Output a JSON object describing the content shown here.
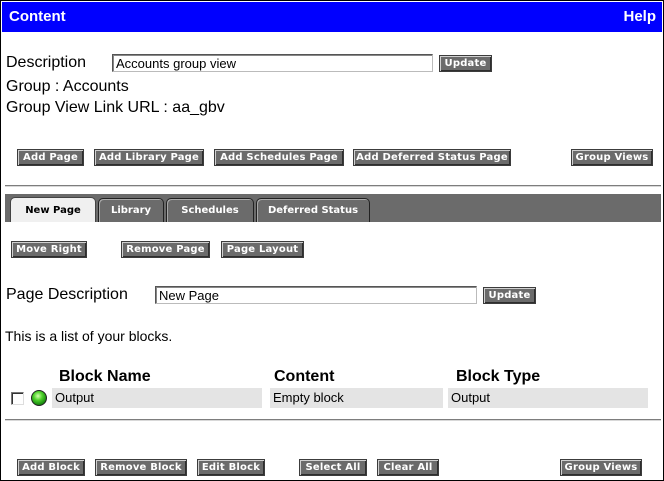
{
  "header": {
    "title": "Content",
    "help": "Help"
  },
  "description": {
    "label": "Description",
    "value": "Accounts group view",
    "update": "Update"
  },
  "group": {
    "text": "Group : Accounts"
  },
  "link_url": {
    "text": "Group View Link URL : aa_gbv"
  },
  "top_actions": {
    "add_page": "Add Page",
    "add_library_page": "Add Library Page",
    "add_schedules_page": "Add Schedules Page",
    "add_deferred_status_page": "Add Deferred Status Page",
    "group_views": "Group Views"
  },
  "tabs": [
    {
      "label": "New Page",
      "active": true
    },
    {
      "label": "Library",
      "active": false
    },
    {
      "label": "Schedules",
      "active": false
    },
    {
      "label": "Deferred Status",
      "active": false
    }
  ],
  "page_actions": {
    "move_right": "Move Right",
    "remove_page": "Remove Page",
    "page_layout": "Page Layout"
  },
  "page_description": {
    "label": "Page Description",
    "value": "New Page",
    "update": "Update"
  },
  "blocks_intro": "This is a list of your blocks.",
  "blocks_table": {
    "headers": [
      "Block Name",
      "Content",
      "Block Type"
    ],
    "rows": [
      {
        "name": "Output",
        "content": "Empty block",
        "type": "Output",
        "status_icon": "green-status-light-icon",
        "checked": false
      }
    ]
  },
  "bottom_actions": {
    "add_block": "Add Block",
    "remove_block": "Remove Block",
    "edit_block": "Edit Block",
    "select_all": "Select All",
    "clear_all": "Clear All",
    "group_views": "Group Views"
  },
  "colors": {
    "titlebar": "#0000ff",
    "button": "#6b6b6b",
    "row_bg": "#e4e4e4",
    "status_green": "#4fd22b"
  }
}
